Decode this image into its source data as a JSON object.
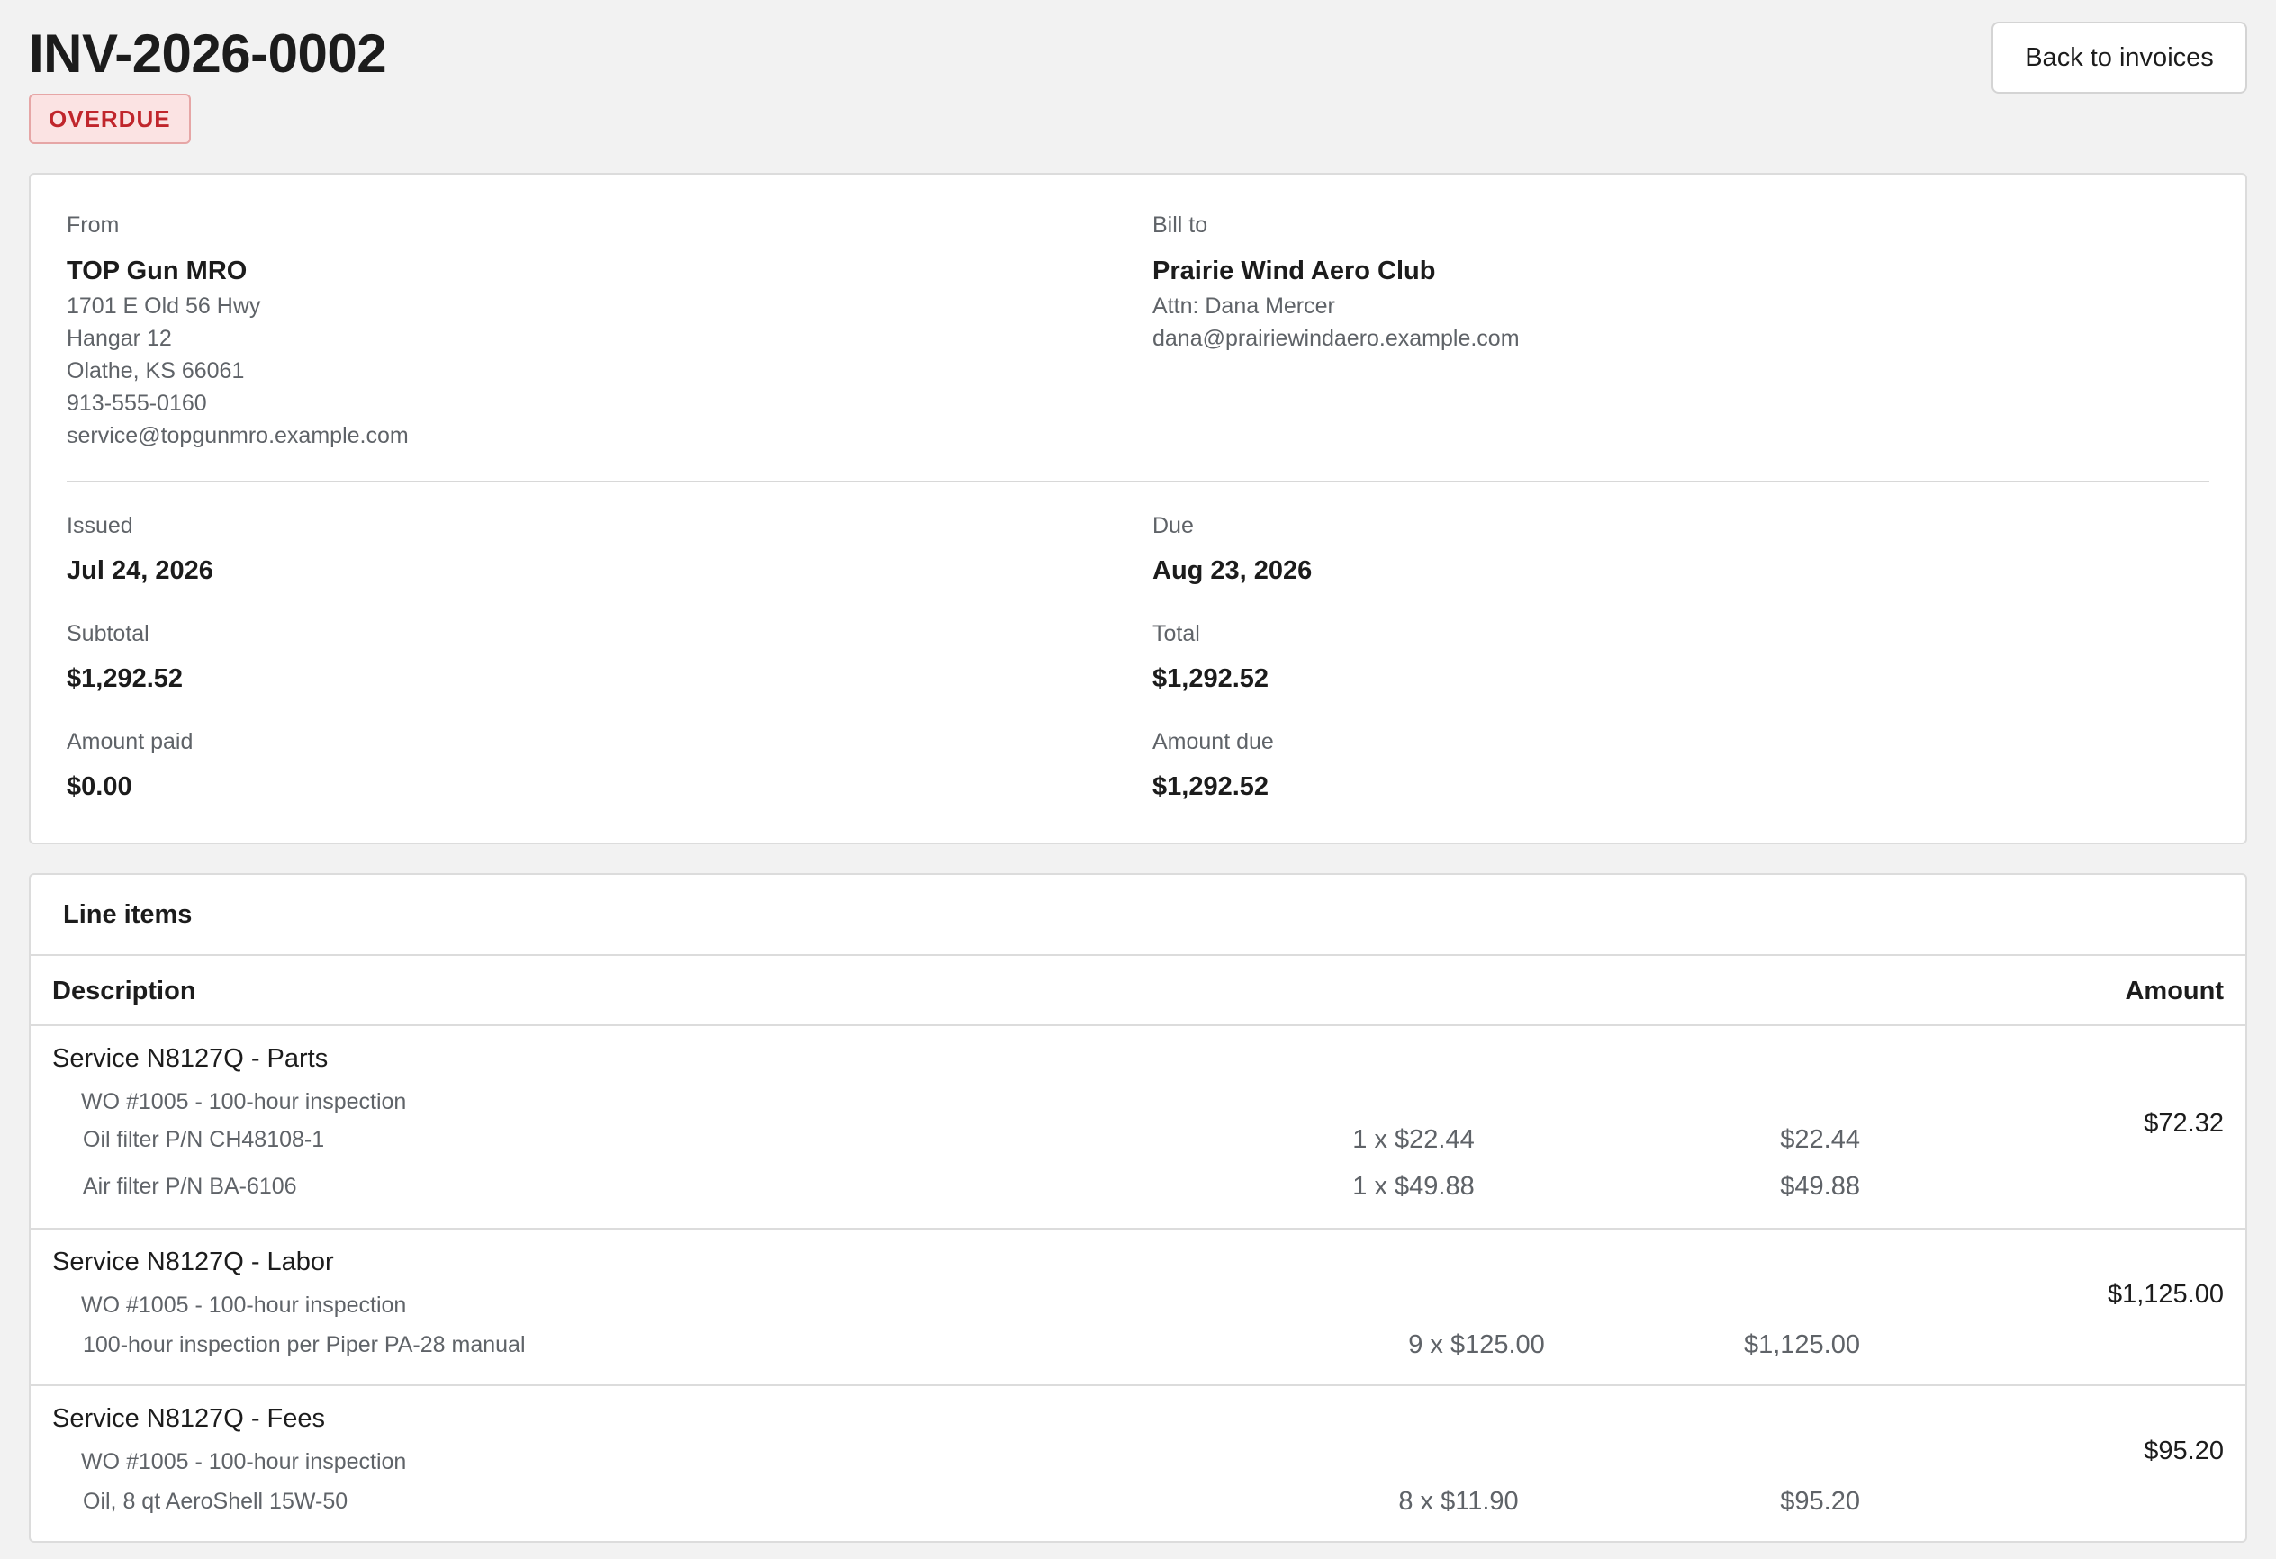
{
  "header": {
    "invoice_number": "INV-2026-0002",
    "status": "OVERDUE",
    "back_button": "Back to invoices"
  },
  "from": {
    "label": "From",
    "name": "TOP Gun MRO",
    "address_lines": [
      "1701 E Old 56 Hwy",
      "Hangar 12",
      "Olathe, KS 66061",
      "913-555-0160",
      "service@topgunmro.example.com"
    ]
  },
  "bill_to": {
    "label": "Bill to",
    "name": "Prairie Wind Aero Club",
    "attn": "Attn: Dana Mercer",
    "email": "dana@prairiewindaero.example.com"
  },
  "summary": {
    "issued": {
      "label": "Issued",
      "value": "Jul 24, 2026"
    },
    "due": {
      "label": "Due",
      "value": "Aug 23, 2026"
    },
    "subtotal": {
      "label": "Subtotal",
      "value": "$1,292.52"
    },
    "total": {
      "label": "Total",
      "value": "$1,292.52"
    },
    "amount_paid": {
      "label": "Amount paid",
      "value": "$0.00"
    },
    "amount_due": {
      "label": "Amount due",
      "value": "$1,292.52"
    }
  },
  "line_items": {
    "title": "Line items",
    "columns": {
      "description": "Description",
      "amount": "Amount"
    },
    "groups": [
      {
        "title": "Service N8127Q - Parts",
        "work_order": "WO #1005 - 100-hour inspection",
        "amount": "$72.32",
        "lines": [
          {
            "description": "Oil filter P/N CH48108-1",
            "qty_price": "1 x $22.44",
            "amount": "$22.44"
          },
          {
            "description": "Air filter P/N BA-6106",
            "qty_price": "1 x $49.88",
            "amount": "$49.88"
          }
        ]
      },
      {
        "title": "Service N8127Q - Labor",
        "work_order": "WO #1005 - 100-hour inspection",
        "amount": "$1,125.00",
        "lines": [
          {
            "description": "100-hour inspection per Piper PA-28 manual",
            "qty_price": "9 x $125.00",
            "amount": "$1,125.00"
          }
        ]
      },
      {
        "title": "Service N8127Q - Fees",
        "work_order": "WO #1005 - 100-hour inspection",
        "amount": "$95.20",
        "lines": [
          {
            "description": "Oil, 8 qt AeroShell 15W-50",
            "qty_price": "8 x $11.90",
            "amount": "$95.20"
          }
        ]
      }
    ]
  }
}
